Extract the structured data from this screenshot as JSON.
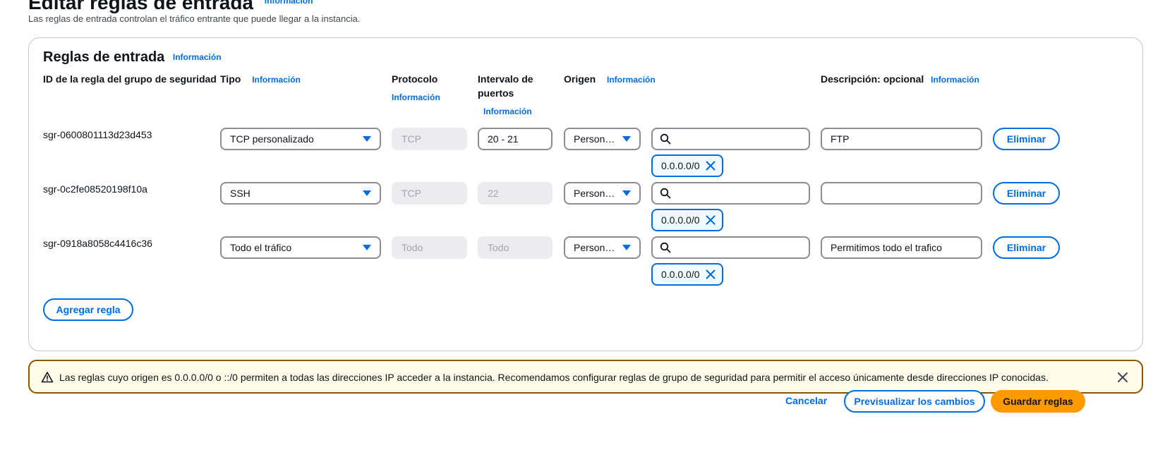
{
  "page": {
    "title": "Editar reglas de entrada",
    "title_info": "Información",
    "description": "Las reglas de entrada controlan el tráfico entrante que puede llegar a la instancia."
  },
  "panel": {
    "title": "Reglas de entrada",
    "title_info": "Información",
    "columns": {
      "rule_id": "ID de la regla del grupo de seguridad",
      "type": "Tipo",
      "type_info": "Información",
      "protocol": "Protocolo",
      "protocol_info": "Información",
      "port_range_line1": "Intervalo de",
      "port_range_line2": "puertos",
      "port_range_info": "Información",
      "source": "Origen",
      "source_info": "Información",
      "description": "Descripción: opcional",
      "description_info": "Información"
    },
    "rules": [
      {
        "id": "sgr-0600801113d23d453",
        "type": "TCP personalizado",
        "protocol": "TCP",
        "port_range": "20 - 21",
        "port_editable": true,
        "source_type": "Person…",
        "source_search": "",
        "cidr": "0.0.0.0/0",
        "description": "FTP",
        "delete_label": "Eliminar"
      },
      {
        "id": "sgr-0c2fe08520198f10a",
        "type": "SSH",
        "protocol": "TCP",
        "port_range": "22",
        "port_editable": false,
        "source_type": "Person…",
        "source_search": "",
        "cidr": "0.0.0.0/0",
        "description": "",
        "delete_label": "Eliminar"
      },
      {
        "id": "sgr-0918a8058c4416c36",
        "type": "Todo el tráfico",
        "protocol": "Todo",
        "port_range": "Todo",
        "port_editable": false,
        "source_type": "Person…",
        "source_search": "",
        "cidr": "0.0.0.0/0",
        "description": "Permitimos todo el trafico",
        "delete_label": "Eliminar"
      }
    ],
    "add_rule_label": "Agregar regla"
  },
  "alert": {
    "text": "Las reglas cuyo origen es 0.0.0.0/0 o ::/0 permiten a todas las direcciones IP acceder a la instancia. Recomendamos configurar reglas de grupo de seguridad para permitir el acceso únicamente desde direcciones IP conocidas.",
    "icon": "warning-icon"
  },
  "footer": {
    "cancel_label": "Cancelar",
    "preview_label": "Previsualizar los cambios",
    "save_label": "Guardar reglas"
  },
  "colors": {
    "accent": "#006ce0",
    "primary_button": "#ff9900",
    "warning_border": "#855900",
    "warning_bg": "#fffce9"
  }
}
